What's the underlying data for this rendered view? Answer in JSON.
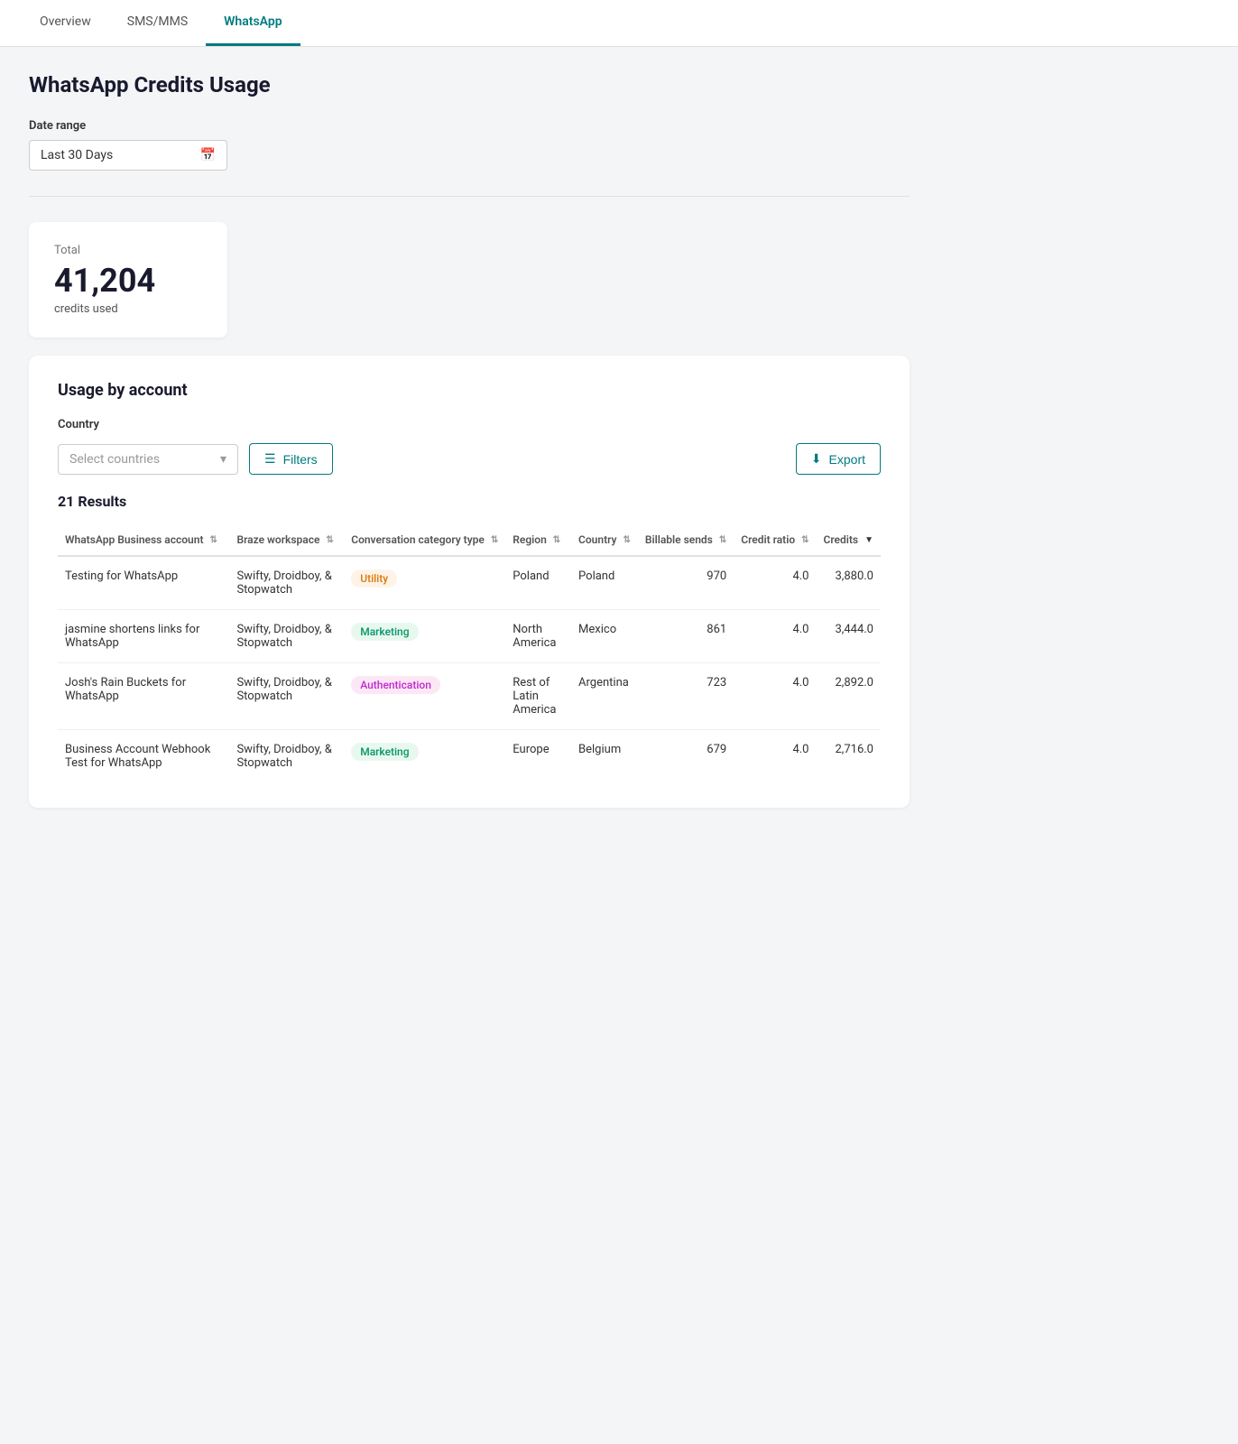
{
  "nav": {
    "tabs": [
      {
        "id": "overview",
        "label": "Overview",
        "active": false
      },
      {
        "id": "sms-mms",
        "label": "SMS/MMS",
        "active": false
      },
      {
        "id": "whatsapp",
        "label": "WhatsApp",
        "active": true
      }
    ]
  },
  "page": {
    "title": "WhatsApp Credits Usage",
    "date_range": {
      "label": "Date range",
      "value": "Last 30 Days"
    },
    "stats": {
      "label": "Total",
      "value": "41,204",
      "sublabel": "credits used"
    },
    "usage_section": {
      "title": "Usage by account",
      "country_filter": {
        "label": "Country",
        "placeholder": "Select countries"
      },
      "filters_btn": "Filters",
      "export_btn": "Export",
      "results_count": "21 Results",
      "table": {
        "columns": [
          {
            "id": "whatsapp-account",
            "label": "WhatsApp Business account",
            "sortable": true
          },
          {
            "id": "braze-workspace",
            "label": "Braze workspace",
            "sortable": true
          },
          {
            "id": "conversation-category",
            "label": "Conversation category type",
            "sortable": true
          },
          {
            "id": "region",
            "label": "Region",
            "sortable": true
          },
          {
            "id": "country",
            "label": "Country",
            "sortable": true
          },
          {
            "id": "billable-sends",
            "label": "Billable sends",
            "sortable": true
          },
          {
            "id": "credit-ratio",
            "label": "Credit ratio",
            "sortable": true
          },
          {
            "id": "credits",
            "label": "Credits",
            "sortable": true,
            "sort_active": true,
            "sort_dir": "desc"
          }
        ],
        "rows": [
          {
            "account": "Testing for WhatsApp",
            "workspace": "Swifty, Droidboy, & Stopwatch",
            "category": "Utility",
            "category_type": "utility",
            "region": "Poland",
            "country": "Poland",
            "billable_sends": "970",
            "credit_ratio": "4.0",
            "credits": "3,880.0"
          },
          {
            "account": "jasmine shortens links for WhatsApp",
            "workspace": "Swifty, Droidboy, & Stopwatch",
            "category": "Marketing",
            "category_type": "marketing",
            "region": "North America",
            "country": "Mexico",
            "billable_sends": "861",
            "credit_ratio": "4.0",
            "credits": "3,444.0"
          },
          {
            "account": "Josh's Rain Buckets for WhatsApp",
            "workspace": "Swifty, Droidboy, & Stopwatch",
            "category": "Authentication",
            "category_type": "authentication",
            "region": "Rest of Latin America",
            "country": "Argentina",
            "billable_sends": "723",
            "credit_ratio": "4.0",
            "credits": "2,892.0"
          },
          {
            "account": "Business Account Webhook Test for WhatsApp",
            "workspace": "Swifty, Droidboy, & Stopwatch",
            "category": "Marketing",
            "category_type": "marketing",
            "region": "Europe",
            "country": "Belgium",
            "billable_sends": "679",
            "credit_ratio": "4.0",
            "credits": "2,716.0"
          }
        ]
      }
    }
  },
  "icons": {
    "calendar": "📅",
    "chevron_down": "▾",
    "filters": "≡",
    "export": "⬇",
    "sort_both": "⇅",
    "sort_desc": "▼"
  }
}
